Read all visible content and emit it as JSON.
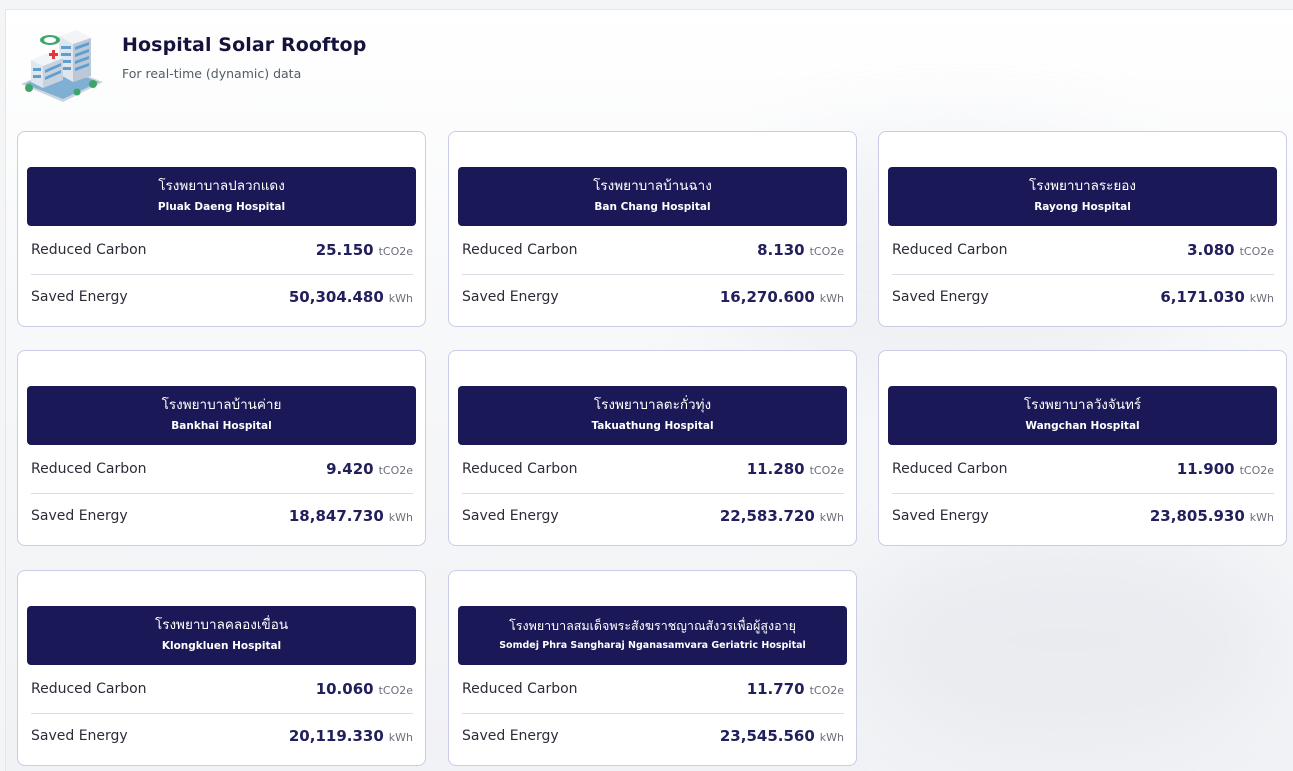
{
  "header": {
    "title": "Hospital Solar Rooftop",
    "subtitle": "For real-time (dynamic) data",
    "logo_icon": "hospital-building-icon"
  },
  "labels": {
    "reduced_carbon": "Reduced Carbon",
    "saved_energy": "Saved Energy",
    "carbon_unit": "tCO2e",
    "energy_unit": "kWh"
  },
  "colors": {
    "card_header": "#1a1856",
    "value_text": "#22205c",
    "card_border": "#c9cce6"
  },
  "hospitals": [
    {
      "thai": "โรงพยาบาลปลวกแดง",
      "name": "Pluak Daeng Hospital",
      "carbon": "25.150",
      "energy": "50,304.480"
    },
    {
      "thai": "โรงพยาบาลบ้านฉาง",
      "name": "Ban Chang Hospital",
      "carbon": "8.130",
      "energy": "16,270.600"
    },
    {
      "thai": "โรงพยาบาลระยอง",
      "name": "Rayong Hospital",
      "carbon": "3.080",
      "energy": "6,171.030"
    },
    {
      "thai": "โรงพยาบาลบ้านค่าย",
      "name": "Bankhai Hospital",
      "carbon": "9.420",
      "energy": "18,847.730"
    },
    {
      "thai": "โรงพยาบาลตะกั่วทุ่ง",
      "name": "Takuathung Hospital",
      "carbon": "11.280",
      "energy": "22,583.720"
    },
    {
      "thai": "โรงพยาบาลวังจันทร์",
      "name": "Wangchan Hospital",
      "carbon": "11.900",
      "energy": "23,805.930"
    },
    {
      "thai": "โรงพยาบาลคลองเขื่อน",
      "name": "Klongkluen Hospital",
      "carbon": "10.060",
      "energy": "20,119.330"
    },
    {
      "thai": "โรงพยาบาลสมเด็จพระสังฆราชญาณสังวรเพื่อผู้สูงอายุ",
      "name": "Somdej Phra Sangharaj Nganasamvara Geriatric Hospital",
      "carbon": "11.770",
      "energy": "23,545.560"
    }
  ]
}
